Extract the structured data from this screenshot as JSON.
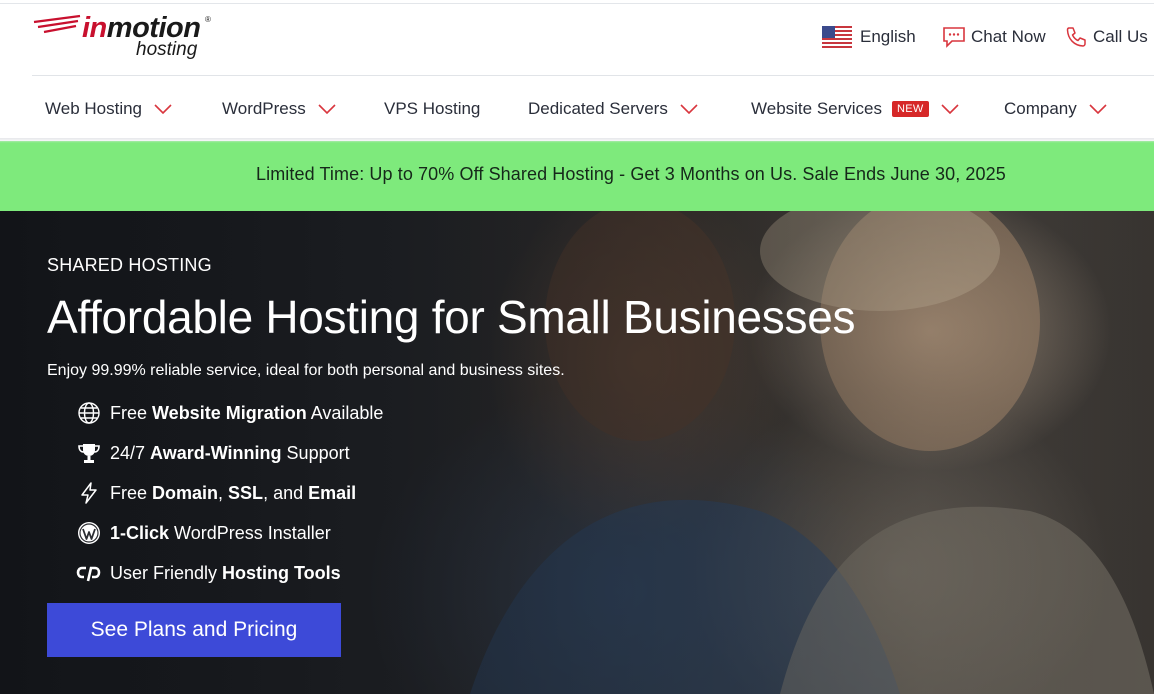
{
  "brand": {
    "logo_main_prefix": "in",
    "logo_main_rest": "motion",
    "logo_registered": "®",
    "logo_sub": "hosting",
    "accent_color": "#c8102e"
  },
  "utility": {
    "language": {
      "icon": "us-flag-icon",
      "label": "English"
    },
    "chat": {
      "icon": "chat-bubble-icon",
      "label": "Chat Now"
    },
    "call": {
      "icon": "phone-icon",
      "label": "Call Us"
    },
    "icon_color": "#d9363e"
  },
  "nav": {
    "items": [
      {
        "label": "Web Hosting",
        "has_dropdown": true
      },
      {
        "label": "WordPress",
        "has_dropdown": true
      },
      {
        "label": "VPS Hosting",
        "has_dropdown": false
      },
      {
        "label": "Dedicated Servers",
        "has_dropdown": true
      },
      {
        "label": "Website Services",
        "has_dropdown": true,
        "badge": "NEW"
      },
      {
        "label": "Company",
        "has_dropdown": true
      }
    ],
    "chevron_color": "#d9363e"
  },
  "promo": {
    "text": "Limited Time: Up to 70% Off Shared Hosting - Get 3 Months on Us. Sale Ends June 30, 2025",
    "background": "#7eea7c"
  },
  "hero": {
    "eyebrow": "SHARED HOSTING",
    "headline": "Affordable Hosting for Small Businesses",
    "subline": "Enjoy 99.99% reliable service, ideal for both personal and business sites.",
    "features": [
      {
        "icon": "globe-icon",
        "pre": "Free ",
        "bold": "Website Migration",
        "post": " Available"
      },
      {
        "icon": "trophy-icon",
        "pre": "24/7 ",
        "bold": "Award-Winning",
        "post": " Support"
      },
      {
        "icon": "lightning-icon",
        "pre": "Free ",
        "bold": "Domain",
        "mid1": ", ",
        "bold2": "SSL",
        "mid2": ", and ",
        "bold3": "Email"
      },
      {
        "icon": "wordpress-icon",
        "bold": "1-Click",
        "post": " WordPress Installer"
      },
      {
        "icon": "cpanel-icon",
        "pre": "User Friendly ",
        "bold": "Hosting Tools"
      }
    ],
    "cta_label": "See Plans and Pricing",
    "cta_color": "#3d4ad8"
  }
}
